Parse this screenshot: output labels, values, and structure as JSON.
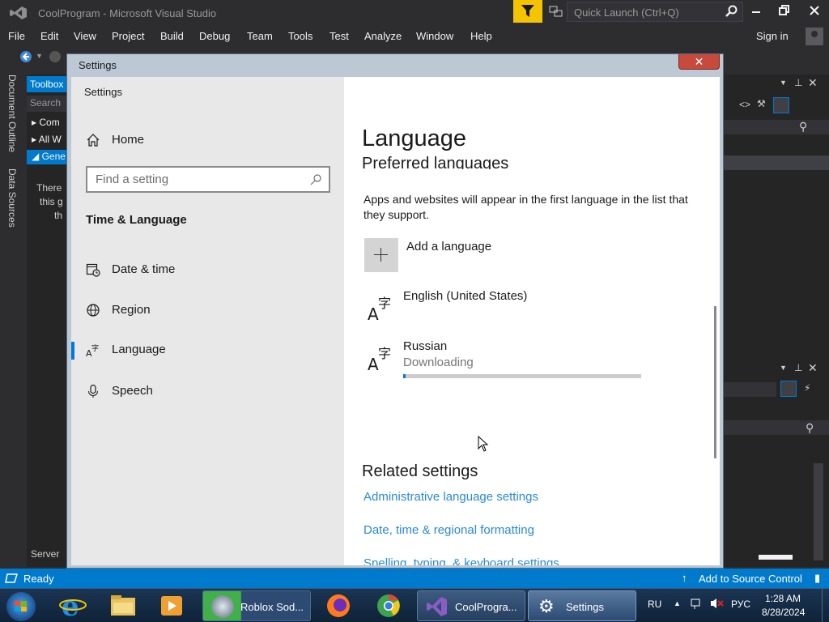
{
  "vs": {
    "title": "CoolProgram - Microsoft Visual Studio",
    "quick_launch_placeholder": "Quick Launch (Ctrl+Q)",
    "menu": [
      "File",
      "Edit",
      "View",
      "Project",
      "Build",
      "Debug",
      "Team",
      "Tools",
      "Test",
      "Analyze",
      "Window",
      "Help"
    ],
    "sign_in": "Sign in",
    "left_tabs": [
      "Document Outline",
      "Data Sources"
    ],
    "toolbox": {
      "header": "Toolbox",
      "search": "Search",
      "rows": [
        "Com",
        "All W",
        "Gene"
      ],
      "message_lines": [
        "There",
        "this g",
        "th"
      ],
      "server": "Server"
    },
    "status": {
      "ready": "Ready",
      "source_control": "Add to Source Control"
    }
  },
  "settings": {
    "window_caption": "Settings",
    "close_glyph": "✕",
    "app_title": "Settings",
    "nav": {
      "home": "Home",
      "search_placeholder": "Find a setting",
      "section": "Time & Language",
      "items": [
        "Date & time",
        "Region",
        "Language",
        "Speech"
      ],
      "selected": "Language"
    },
    "main": {
      "title": "Language",
      "subtitle": "Preferred languages",
      "description": "Apps and websites will appear in the first language in the list that they support.",
      "add_language": "Add a language",
      "languages": [
        {
          "name": "English (United States)",
          "status": "",
          "progress": null
        },
        {
          "name": "Russian",
          "status": "Downloading",
          "progress": 0.01
        }
      ],
      "related_title": "Related settings",
      "related_links": [
        "Administrative language settings",
        "Date, time & regional formatting",
        "Spelling, typing, & keyboard settings"
      ]
    }
  },
  "taskbar": {
    "apps": [
      {
        "label": "Roblox Sod...",
        "active": false
      },
      {
        "label": "CoolProgra...",
        "active": false
      },
      {
        "label": "Settings",
        "active": true
      }
    ],
    "lang_indicator": "RU",
    "keyboard_layout": "РУС",
    "time": "1:28 AM",
    "date": "8/28/2024"
  }
}
